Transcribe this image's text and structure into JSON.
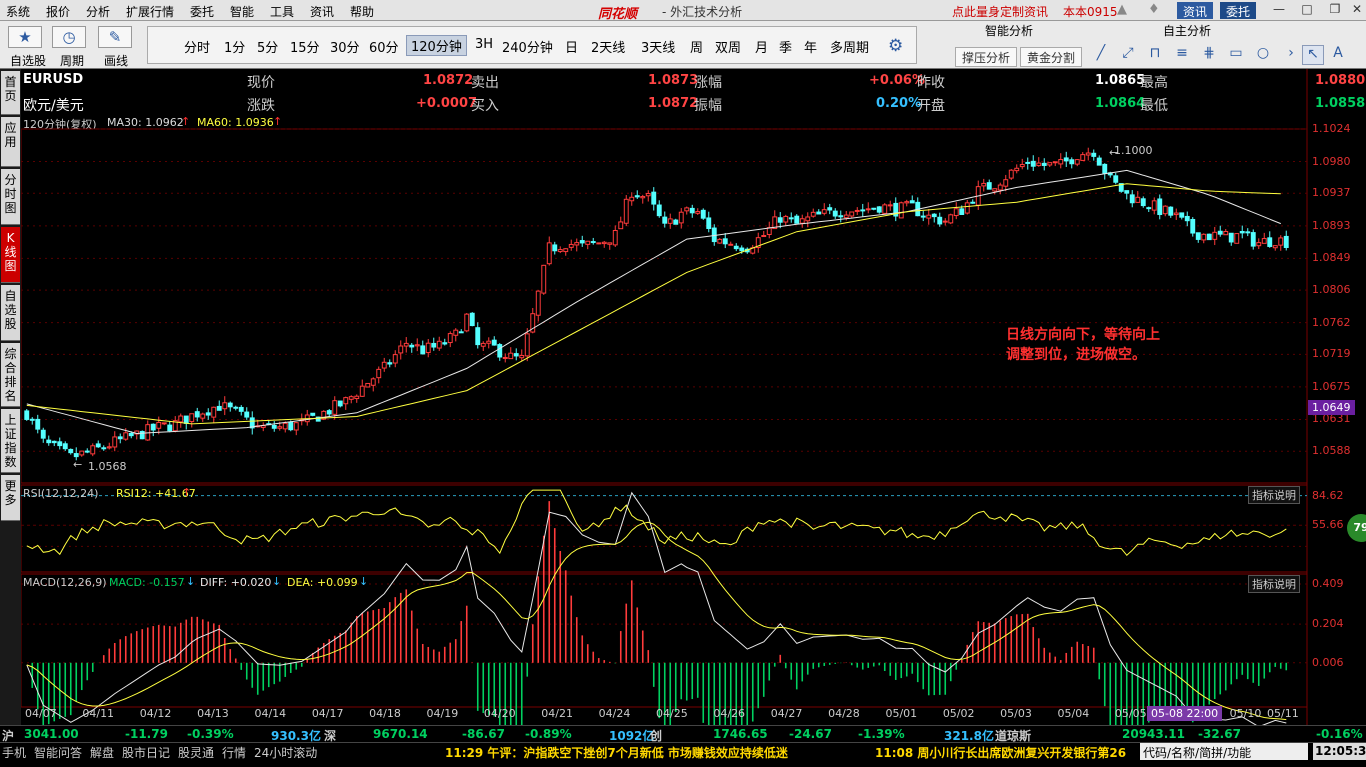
{
  "menubar": {
    "items": [
      "系统",
      "报价",
      "分析",
      "扩展行情",
      "委托",
      "智能",
      "工具",
      "资讯",
      "帮助"
    ],
    "logo": "同花顺",
    "title": "- 外汇技术分析",
    "promo": "点此量身定制资讯",
    "user": "本本0915",
    "btn_news": "资讯",
    "btn_trade": "委托"
  },
  "toolbar": {
    "favorites_label": "自选股",
    "cycle_label": "周期",
    "draw_label": "画线",
    "periods": [
      "分时",
      "1分",
      "5分",
      "15分",
      "30分",
      "60分",
      "120分钟",
      "3H",
      "240分钟",
      "日",
      "2天线",
      "3天线",
      "周",
      "双周",
      "月",
      "季",
      "年",
      "多周期"
    ],
    "active_period": "120分钟",
    "smart_tab": "智能分析",
    "custom_tab": "自主分析",
    "support_btn": "撑压分析",
    "golden_btn": "黄金分割"
  },
  "sidebar": {
    "tabs": [
      "首页",
      "应用",
      "分时图",
      "K线图",
      "自选股",
      "综合排名",
      "上证指数",
      "更多"
    ],
    "active": "K线图"
  },
  "quote": {
    "symbol": "EURUSD",
    "name": "欧元/美元",
    "price_lbl": "现价",
    "price": "1.0872",
    "change_lbl": "涨跌",
    "change": "+0.0007",
    "sell_lbl": "卖出",
    "sell": "1.0873",
    "buy_lbl": "买入",
    "buy": "1.0872",
    "pct_lbl": "涨幅",
    "pct": "+0.06%",
    "amp_lbl": "振幅",
    "amp": "0.20%",
    "prev_lbl": "昨收",
    "prev": "1.0865",
    "open_lbl": "开盘",
    "open": "1.0864",
    "high_lbl": "最高",
    "high": "1.0880",
    "low_lbl": "最低",
    "low": "1.0858"
  },
  "indicators": {
    "main_title": "120分钟(复权)",
    "ma30": "MA30: 1.0962",
    "ma60": "MA60: 1.0936",
    "rsi_title": "RSI(12,12,24)",
    "rsi12": "RSI12: +41.67",
    "macd_title": "MACD(12,26,9)",
    "macd": "MACD: -0.157",
    "diff": "DIFF: +0.020",
    "dea": "DEA: +0.099",
    "explain": "指标说明",
    "high_mark": "1.1000",
    "low_mark": "1.0568",
    "current_tag": "1.0649",
    "rsi_badge": "79",
    "annotation_l1": "日线方向向下，等待向上",
    "annotation_l2": "调整到位，进场做空。",
    "date_tag": "05-08 22:00"
  },
  "chart_data": {
    "type": "candlestick",
    "ylim": [
      1.0545,
      1.1024
    ],
    "y_ticks": [
      "1.1024",
      "1.0980",
      "1.0937",
      "1.0893",
      "1.0849",
      "1.0806",
      "1.0762",
      "1.0719",
      "1.0675",
      "1.0631",
      "1.0588"
    ],
    "rsi_ticks": [
      "84.62",
      "55.66"
    ],
    "macd_ticks": [
      "0.409",
      "0.204",
      "0.006"
    ],
    "x_labels": [
      "04/07",
      "04/11",
      "04/12",
      "04/13",
      "04/14",
      "04/17",
      "04/18",
      "04/19",
      "04/20",
      "04/21",
      "04/24",
      "04/25",
      "04/26",
      "04/27",
      "04/28",
      "05/01",
      "05/02",
      "05/03",
      "05/04",
      "05/05",
      "05/08",
      "05/10",
      "05/11"
    ],
    "anchors": [
      [
        0,
        1.064
      ],
      [
        3,
        1.06
      ],
      [
        8,
        1.058
      ],
      [
        12,
        1.0588
      ],
      [
        16,
        1.06
      ],
      [
        20,
        1.061
      ],
      [
        24,
        1.062
      ],
      [
        27,
        1.0625
      ],
      [
        31,
        1.064
      ],
      [
        35,
        1.065
      ],
      [
        38,
        1.064
      ],
      [
        42,
        1.062
      ],
      [
        46,
        1.062
      ],
      [
        50,
        1.0625
      ],
      [
        54,
        1.064
      ],
      [
        58,
        1.0655
      ],
      [
        61,
        1.0675
      ],
      [
        65,
        1.07
      ],
      [
        69,
        1.0735
      ],
      [
        72,
        1.0725
      ],
      [
        75,
        1.073
      ],
      [
        78,
        1.0745
      ],
      [
        80,
        1.077
      ],
      [
        82,
        1.073
      ],
      [
        85,
        1.0728
      ],
      [
        88,
        1.0715
      ],
      [
        90,
        1.0712
      ],
      [
        92,
        1.077
      ],
      [
        95,
        1.0862
      ],
      [
        98,
        1.087
      ],
      [
        101,
        1.0865
      ],
      [
        104,
        1.087
      ],
      [
        107,
        1.088
      ],
      [
        110,
        1.094
      ],
      [
        113,
        1.093
      ],
      [
        116,
        1.089
      ],
      [
        119,
        1.091
      ],
      [
        122,
        1.0912
      ],
      [
        125,
        1.0875
      ],
      [
        128,
        1.087
      ],
      [
        131,
        1.0865
      ],
      [
        134,
        1.088
      ],
      [
        137,
        1.0905
      ],
      [
        140,
        1.0895
      ],
      [
        143,
        1.0905
      ],
      [
        146,
        1.091
      ],
      [
        149,
        1.0915
      ],
      [
        152,
        1.0915
      ],
      [
        155,
        1.092
      ],
      [
        158,
        1.0915
      ],
      [
        161,
        1.0918
      ],
      [
        164,
        1.0905
      ],
      [
        167,
        1.09
      ],
      [
        170,
        1.0915
      ],
      [
        173,
        1.094
      ],
      [
        176,
        1.095
      ],
      [
        179,
        1.0965
      ],
      [
        182,
        1.098
      ],
      [
        185,
        1.0975
      ],
      [
        188,
        1.0975
      ],
      [
        191,
        1.099
      ],
      [
        194,
        1.0995
      ],
      [
        197,
        1.0955
      ],
      [
        200,
        1.0935
      ],
      [
        203,
        1.0925
      ],
      [
        206,
        1.0915
      ],
      [
        209,
        1.0905
      ],
      [
        212,
        1.0885
      ],
      [
        215,
        1.088
      ],
      [
        218,
        1.0878
      ],
      [
        221,
        1.088
      ],
      [
        224,
        1.087
      ],
      [
        227,
        1.0875
      ],
      [
        229,
        1.0872
      ]
    ],
    "ma30": [
      [
        0,
        1.0652
      ],
      [
        20,
        1.0612
      ],
      [
        40,
        1.062
      ],
      [
        60,
        1.064
      ],
      [
        80,
        1.07
      ],
      [
        100,
        1.079
      ],
      [
        120,
        1.0875
      ],
      [
        140,
        1.0895
      ],
      [
        160,
        1.0912
      ],
      [
        180,
        1.0945
      ],
      [
        200,
        1.0968
      ],
      [
        215,
        1.0935
      ],
      [
        229,
        1.0893
      ]
    ],
    "ma60": [
      [
        0,
        1.065
      ],
      [
        30,
        1.0625
      ],
      [
        60,
        1.0635
      ],
      [
        80,
        1.067
      ],
      [
        100,
        1.075
      ],
      [
        120,
        1.083
      ],
      [
        140,
        1.0885
      ],
      [
        160,
        1.0912
      ],
      [
        180,
        1.0925
      ],
      [
        200,
        1.095
      ],
      [
        215,
        1.094
      ],
      [
        229,
        1.0936
      ]
    ]
  }
}
